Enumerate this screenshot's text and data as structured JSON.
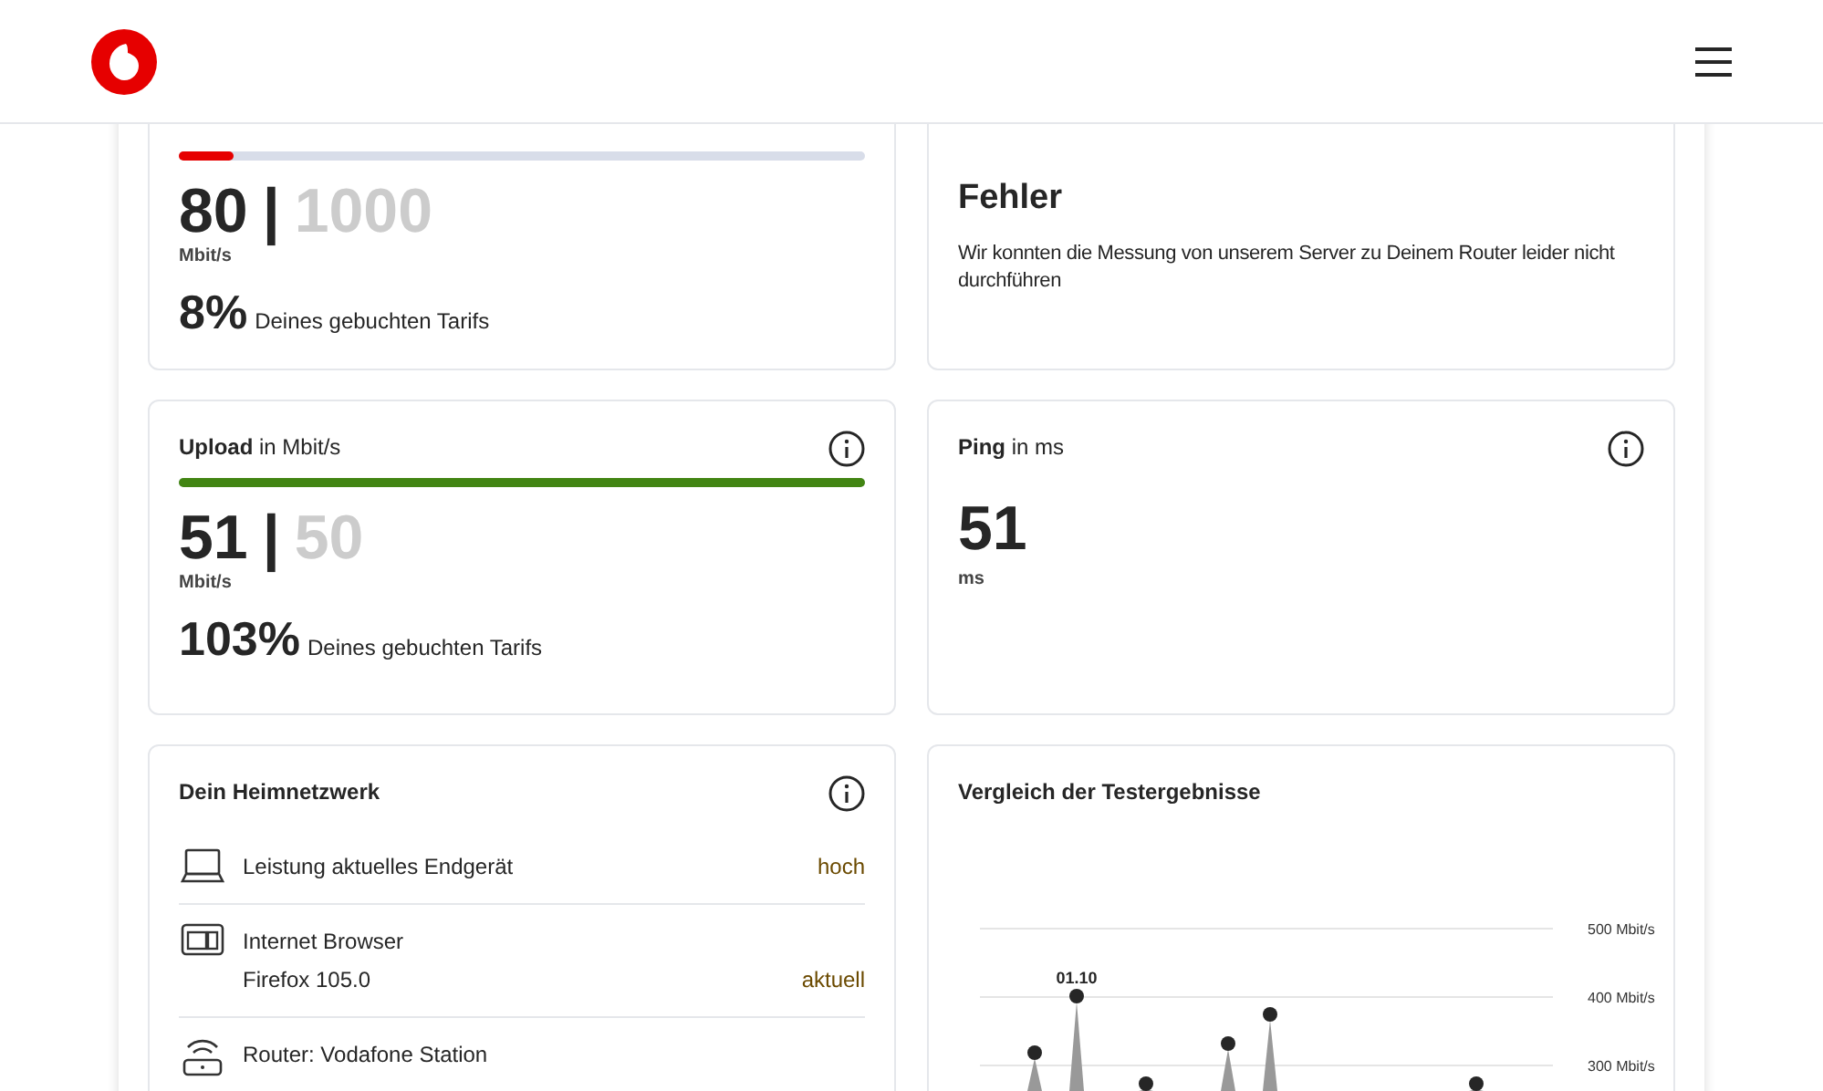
{
  "speed_cards": [
    {
      "kind": "speed",
      "level": 0.08,
      "color": "#e60000",
      "value": "80",
      "separator": "|",
      "booked": "1000",
      "unit": "Mbit/s",
      "percent": "8%",
      "percent_label": "Deines gebuchten Tarifs"
    },
    {
      "kind": "error",
      "title": "Fehler",
      "message": "Wir konnten die Messung von unserem Server zu Deinem Router leider nicht durchführen"
    },
    {
      "kind": "speed",
      "title": "Upload",
      "unit_label": "in Mbit/s",
      "level": 1,
      "color": "#428513",
      "value": "51",
      "separator": "|",
      "booked": "50",
      "unit": "Mbit/s",
      "percent": "103%",
      "percent_label": "Deines gebuchten Tarifs",
      "info": true
    },
    {
      "kind": "ping",
      "title": "Ping",
      "unit_label": "in ms",
      "value": "51",
      "unit": "ms",
      "info": true
    }
  ],
  "home_network": {
    "title": "Dein Heimnetzwerk",
    "info": true,
    "rows": [
      {
        "kind": "laptop",
        "label": "Leistung aktuelles Endgerät",
        "value": "hoch"
      },
      {
        "kind": "browser",
        "label": "Internet Browser",
        "detail": "Firefox 105.0",
        "value": "aktuell"
      },
      {
        "kind": "router",
        "label": "Router: Vodafone Station"
      }
    ]
  },
  "comparison": {
    "title": "Vergleich der Testergebnisse",
    "axis_labels": [
      "500 Mbit/s",
      "400 Mbit/s",
      "300 Mbit/s"
    ],
    "point_label": "01.10"
  }
}
